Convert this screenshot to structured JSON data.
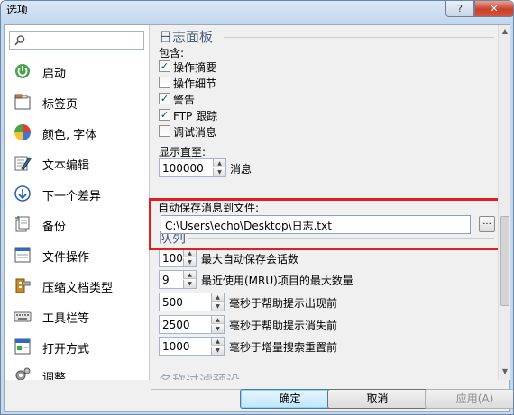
{
  "window": {
    "title": "选项",
    "help_label": "?",
    "close_label": "✕"
  },
  "search": {
    "placeholder": ""
  },
  "sidebar": {
    "items": [
      {
        "label": "启动",
        "icon": "power-icon"
      },
      {
        "label": "标签页",
        "icon": "tabs-icon"
      },
      {
        "label": "颜色, 字体",
        "icon": "palette-icon"
      },
      {
        "label": "文本编辑",
        "icon": "edit-icon"
      },
      {
        "label": "下一个差异",
        "icon": "next-diff-icon"
      },
      {
        "label": "备份",
        "icon": "backup-icon"
      },
      {
        "label": "文件操作",
        "icon": "file-ops-icon"
      },
      {
        "label": "压缩文档类型",
        "icon": "archive-icon"
      },
      {
        "label": "工具栏等",
        "icon": "keyboard-icon"
      },
      {
        "label": "打开方式",
        "icon": "open-with-icon"
      },
      {
        "label": "调整",
        "icon": "tweak-icon"
      }
    ]
  },
  "log_panel": {
    "title": "日志面板",
    "include_label": "包含:",
    "checkboxes": [
      {
        "label": "操作摘要",
        "checked": true
      },
      {
        "label": "操作细节",
        "checked": false
      },
      {
        "label": "警告",
        "checked": true
      },
      {
        "label": "FTP 跟踪",
        "checked": true
      },
      {
        "label": "调试消息",
        "checked": false
      }
    ],
    "show_until_label": "显示直至:",
    "show_until_value": "100000",
    "show_until_unit": "消息",
    "autosave_label": "自动保存消息到文件:",
    "autosave_path": "C:\\Users\\echo\\Desktop\\日志.txt",
    "browse_label": "..."
  },
  "queue": {
    "title": "队列",
    "rows": [
      {
        "value": "100",
        "label": "最大自动保存会话数"
      },
      {
        "value": "9",
        "label": "最近使用(MRU)项目的最大数量"
      },
      {
        "value": "500",
        "label": "毫秒于帮助提示出现前"
      },
      {
        "value": "2500",
        "label": "毫秒于帮助提示消失前"
      },
      {
        "value": "1000",
        "label": "毫秒于增量搜索重置前"
      }
    ]
  },
  "next_section_title": "名称过滤预设",
  "buttons": {
    "ok": "确定",
    "cancel": "取消",
    "apply": "应用(A)"
  },
  "colors": {
    "highlight": "#e01f1f",
    "section_title": "#4a5d78"
  }
}
